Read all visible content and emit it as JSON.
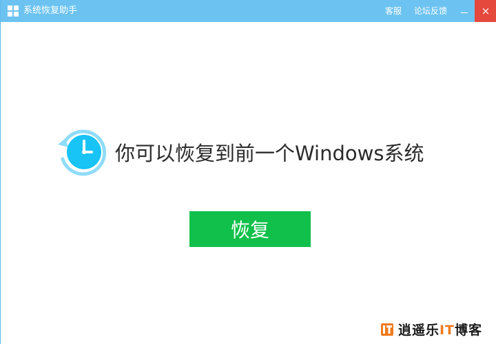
{
  "window": {
    "title": "系统恢复助手",
    "links": [
      "客服",
      "论坛反馈"
    ],
    "minimize_icon": "minimize-icon",
    "close_symbol": "×"
  },
  "main": {
    "icon": "restore-clock-icon",
    "headline": "你可以恢复到前一个Windows系统",
    "button_label": "恢复"
  },
  "watermark": {
    "prefix": "逍遥乐",
    "it": "IT",
    "suffix": "博客"
  },
  "colors": {
    "titlebar": "#6cc3f1",
    "button": "#10c04a",
    "close": "#e5483c",
    "icon": "#18c3f5",
    "watermark_accent": "#f07a1c"
  }
}
